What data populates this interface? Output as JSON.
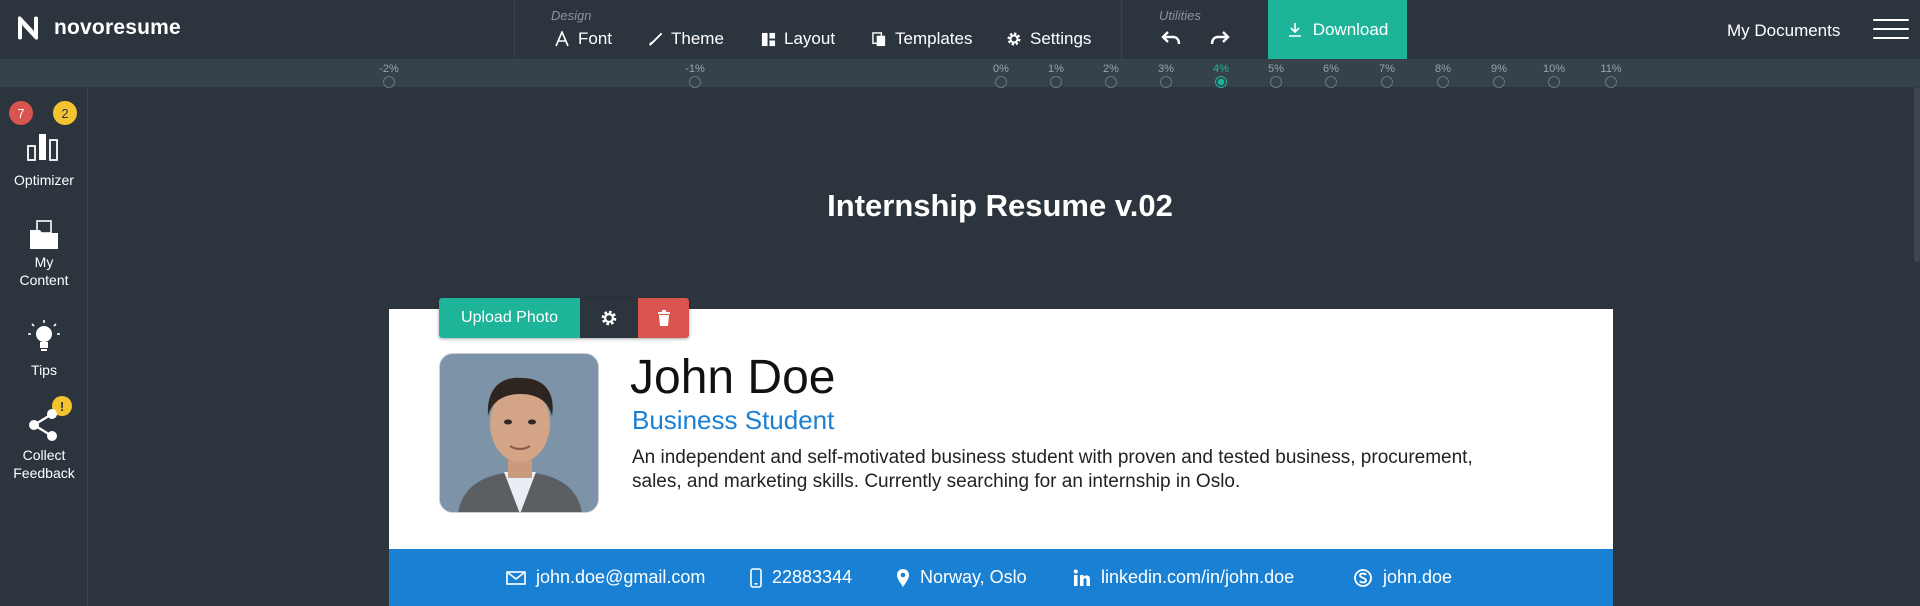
{
  "brand": {
    "name": "novoresume"
  },
  "design": {
    "label": "Design",
    "items": [
      {
        "label": "Font",
        "icon": "font-icon"
      },
      {
        "label": "Theme",
        "icon": "brush-icon"
      },
      {
        "label": "Layout",
        "icon": "layout-icon"
      },
      {
        "label": "Templates",
        "icon": "templates-icon"
      },
      {
        "label": "Settings",
        "icon": "gear-icon"
      }
    ]
  },
  "utilities": {
    "label": "Utilities",
    "undo_icon": "undo-icon",
    "redo_icon": "redo-icon"
  },
  "download": {
    "label": "Download",
    "color": "#1eb49a"
  },
  "nav": {
    "my_documents": "My Documents"
  },
  "ruler": {
    "ticks": [
      "-2%",
      "-1%",
      "0%",
      "1%",
      "2%",
      "3%",
      "4%",
      "5%",
      "6%",
      "7%",
      "8%",
      "9%",
      "10%",
      "11%"
    ],
    "active": "4%"
  },
  "sidebar": {
    "optimizer": {
      "label": "Optimizer",
      "badge_red": "7",
      "badge_yellow": "2"
    },
    "my_content": {
      "label_line1": "My",
      "label_line2": "Content"
    },
    "tips": {
      "label": "Tips"
    },
    "collect_feedback": {
      "label_line1": "Collect",
      "label_line2": "Feedback",
      "badge": "!"
    }
  },
  "document": {
    "title": "Internship Resume v.02"
  },
  "photo_toolbar": {
    "upload_label": "Upload Photo"
  },
  "resume": {
    "name": "John Doe",
    "role": "Business Student",
    "summary": "An independent and self-motivated business student with proven and tested business, procurement, sales, and marketing skills. Currently searching for an internship in Oslo.",
    "accent_color": "#1a80d3",
    "contacts": [
      {
        "icon": "email-icon",
        "value": "john.doe@gmail.com"
      },
      {
        "icon": "phone-icon",
        "value": "22883344"
      },
      {
        "icon": "location-icon",
        "value": "Norway, Oslo"
      },
      {
        "icon": "linkedin-icon",
        "value": "linkedin.com/in/john.doe"
      },
      {
        "icon": "skype-icon",
        "value": "john.doe"
      }
    ]
  }
}
